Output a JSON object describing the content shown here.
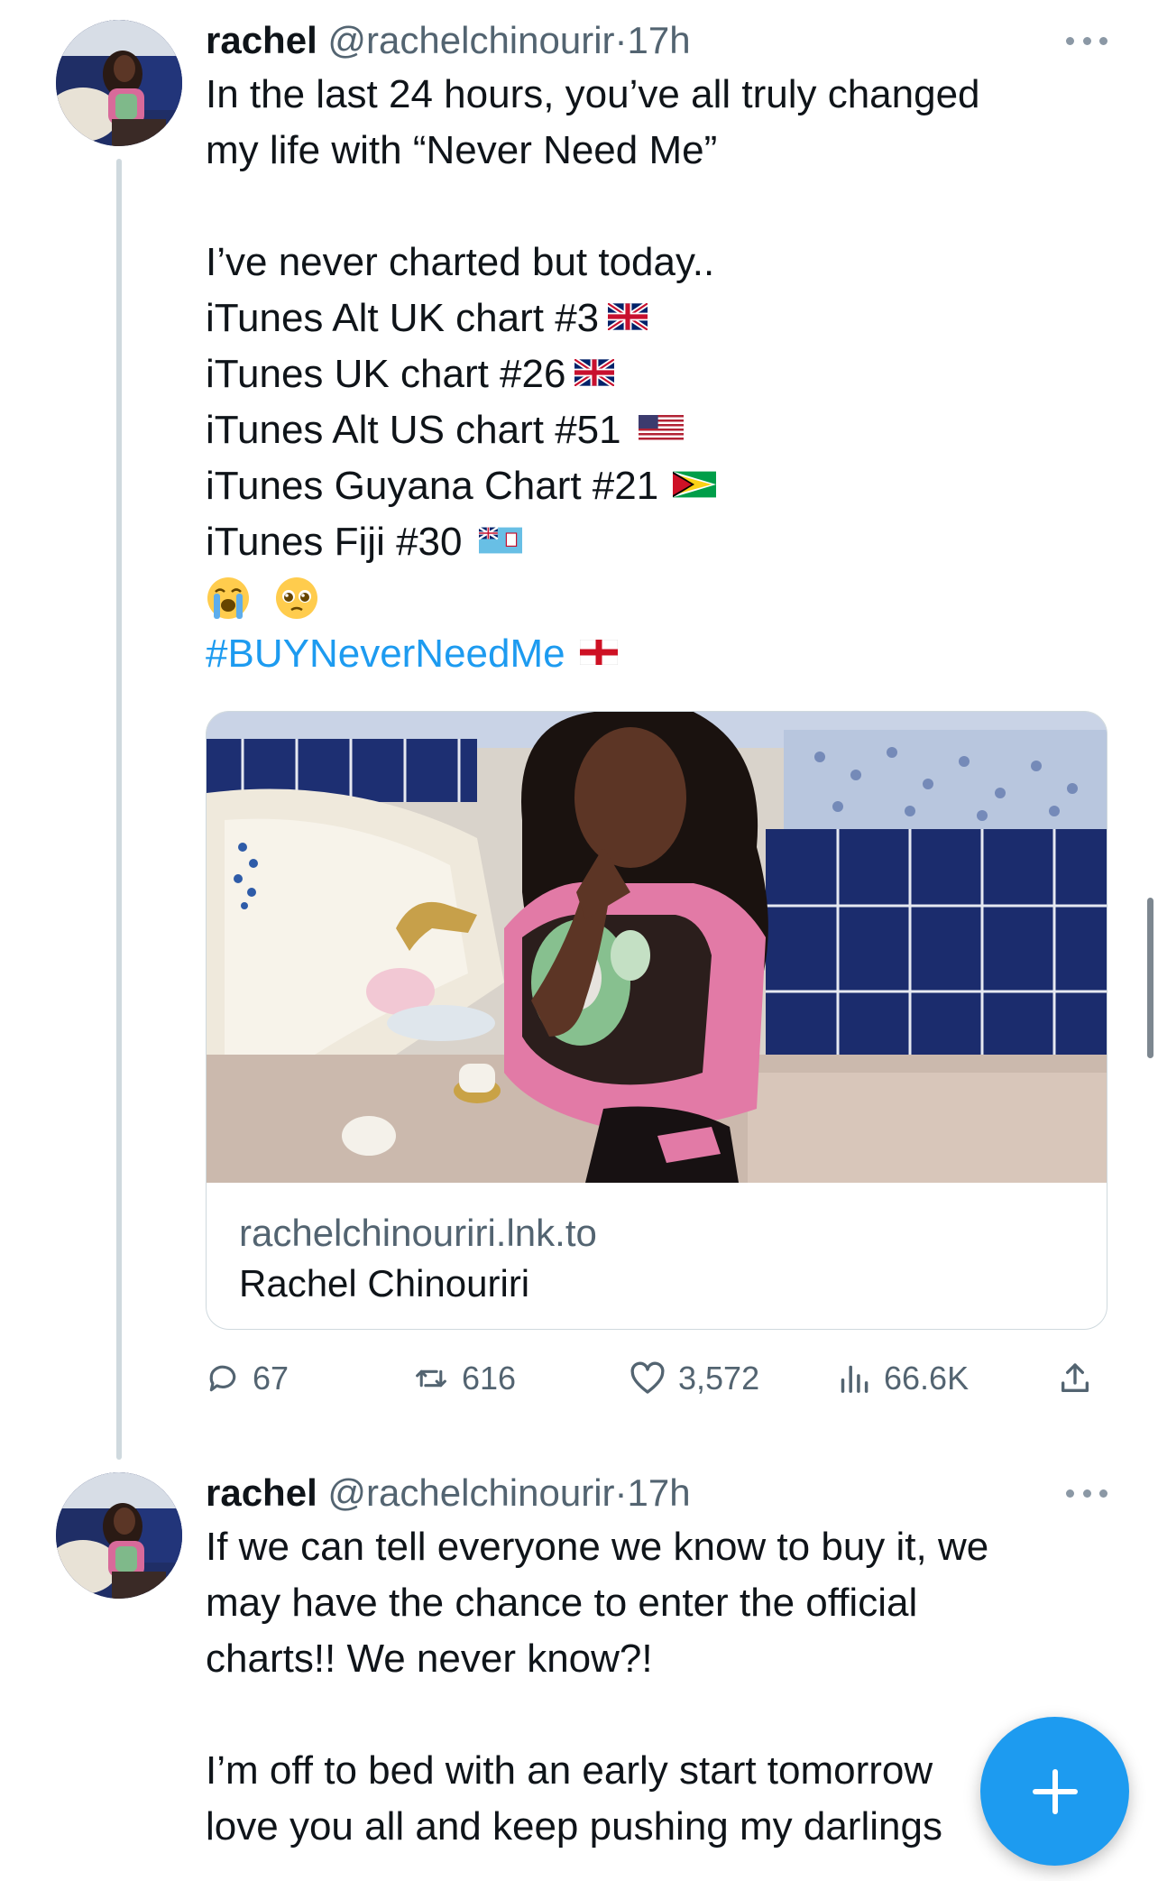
{
  "tweets": [
    {
      "author_name": "rachel",
      "handle": "@rachelchinourir",
      "dot": "·",
      "time": "17h",
      "lines": [
        "In the last 24 hours, you’ve all truly changed",
        "my life with “Never Need Me”",
        "",
        "I’ve never charted but today..",
        "iTunes Alt UK chart #3",
        "iTunes UK chart #26",
        "iTunes Alt US chart #51",
        "iTunes Guyana Chart #21",
        "iTunes Fiji #30"
      ],
      "flags": [
        "uk-flag-icon",
        "uk-flag-icon",
        "us-flag-icon",
        "guyana-flag-icon",
        "fiji-flag-icon",
        "england-flag-icon"
      ],
      "emojis": [
        "loudly-crying-face-icon",
        "pleading-face-icon"
      ],
      "hashtag": "#BUYNeverNeedMe",
      "card": {
        "domain": "rachelchinouriri.lnk.to",
        "title": "Rachel Chinouriri"
      },
      "stats": {
        "replies": "67",
        "reposts": "616",
        "likes": "3,572",
        "views": "66.6K"
      }
    },
    {
      "author_name": "rachel",
      "handle": "@rachelchinourir",
      "dot": "·",
      "time": "17h",
      "lines": [
        "If we can tell everyone we know to buy it, we",
        "may have the chance to enter the official",
        "charts!! We never know?!",
        "",
        "I’m off to bed with an early start tomorrow",
        "love you all and keep pushing my darlings"
      ]
    }
  ],
  "fab": {
    "icon": "plus-icon",
    "color": "#1d9bf0"
  },
  "colors": {
    "link": "#1d9bf0",
    "secondary_text": "#536471",
    "primary_text": "#0f1419"
  }
}
